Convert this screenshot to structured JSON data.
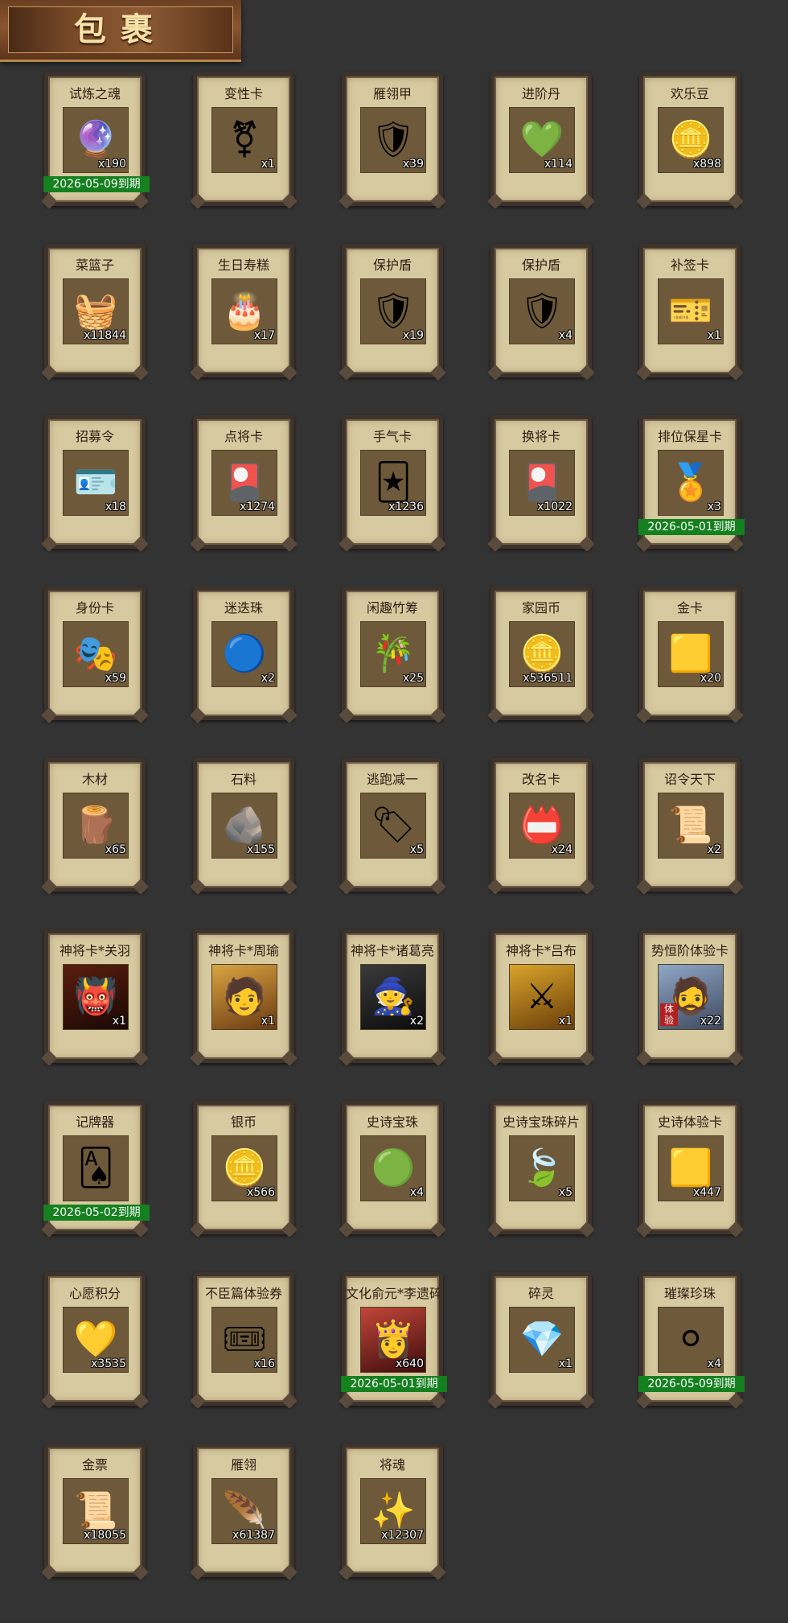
{
  "header": {
    "title": "包裹"
  },
  "colors": {
    "background": "#333333",
    "card": "#d8caa0",
    "expiry": "#15801f"
  },
  "items": [
    {
      "name": "试炼之魂",
      "count": "x190",
      "icon": "soul-orb-icon",
      "glyph": "🔮",
      "expiry": "2026-05-09到期"
    },
    {
      "name": "变性卡",
      "count": "x1",
      "icon": "gender-card-icon",
      "glyph": "⚧",
      "expiry": ""
    },
    {
      "name": "雁翎甲",
      "count": "x39",
      "icon": "armor-icon",
      "glyph": "🛡",
      "expiry": ""
    },
    {
      "name": "进阶丹",
      "count": "x114",
      "icon": "pill-icon",
      "glyph": "💚",
      "expiry": ""
    },
    {
      "name": "欢乐豆",
      "count": "x898",
      "icon": "beans-icon",
      "glyph": "🪙",
      "expiry": ""
    },
    {
      "name": "菜篮子",
      "count": "x11844",
      "icon": "basket-icon",
      "glyph": "🧺",
      "expiry": ""
    },
    {
      "name": "生日寿糕",
      "count": "x17",
      "icon": "cake-icon",
      "glyph": "🎂",
      "expiry": ""
    },
    {
      "name": "保护盾",
      "count": "x19",
      "icon": "shield-icon",
      "glyph": "🛡",
      "expiry": ""
    },
    {
      "name": "保护盾",
      "count": "x4",
      "icon": "shield-icon",
      "glyph": "🛡",
      "expiry": ""
    },
    {
      "name": "补签卡",
      "count": "x1",
      "icon": "sign-card-icon",
      "glyph": "🎫",
      "expiry": ""
    },
    {
      "name": "招募令",
      "count": "x18",
      "icon": "recruit-token-icon",
      "glyph": "🪪",
      "expiry": ""
    },
    {
      "name": "点将卡",
      "count": "x1274",
      "icon": "general-card-icon",
      "glyph": "🎴",
      "expiry": ""
    },
    {
      "name": "手气卡",
      "count": "x1236",
      "icon": "luck-card-icon",
      "glyph": "🃏",
      "expiry": ""
    },
    {
      "name": "换将卡",
      "count": "x1022",
      "icon": "swap-card-icon",
      "glyph": "🎴",
      "expiry": ""
    },
    {
      "name": "排位保星卡",
      "count": "x3",
      "icon": "rank-card-icon",
      "glyph": "🏅",
      "expiry": "2026-05-01到期"
    },
    {
      "name": "身份卡",
      "count": "x59",
      "icon": "identity-card-icon",
      "glyph": "🎭",
      "expiry": ""
    },
    {
      "name": "迷迭珠",
      "count": "x2",
      "icon": "blue-orb-icon",
      "glyph": "🔵",
      "expiry": ""
    },
    {
      "name": "闲趣竹筹",
      "count": "x25",
      "icon": "bamboo-token-icon",
      "glyph": "🎋",
      "expiry": ""
    },
    {
      "name": "家园币",
      "count": "x536511",
      "icon": "home-coin-icon",
      "glyph": "🪙",
      "expiry": ""
    },
    {
      "name": "金卡",
      "count": "x20",
      "icon": "gold-card-icon",
      "glyph": "🟨",
      "expiry": ""
    },
    {
      "name": "木材",
      "count": "x65",
      "icon": "wood-icon",
      "glyph": "🪵",
      "expiry": ""
    },
    {
      "name": "石料",
      "count": "x155",
      "icon": "stone-icon",
      "glyph": "🪨",
      "expiry": ""
    },
    {
      "name": "逃跑减一",
      "count": "x5",
      "icon": "jade-tag-icon",
      "glyph": "🏷",
      "expiry": ""
    },
    {
      "name": "改名卡",
      "count": "x24",
      "icon": "rename-card-icon",
      "glyph": "📛",
      "expiry": ""
    },
    {
      "name": "诏令天下",
      "count": "x2",
      "icon": "edict-scroll-icon",
      "glyph": "📜",
      "expiry": ""
    },
    {
      "name": "神将卡*关羽",
      "count": "x1",
      "icon": "guanyu-portrait-icon",
      "glyph": "👹",
      "expiry": "",
      "portrait": [
        "#5a1e0e",
        "#1a0805"
      ]
    },
    {
      "name": "神将卡*周瑜",
      "count": "x1",
      "icon": "zhouyu-portrait-icon",
      "glyph": "🧑",
      "expiry": "",
      "portrait": [
        "#d9a441",
        "#6b3a12"
      ]
    },
    {
      "name": "神将卡*诸葛亮",
      "count": "x2",
      "icon": "zhugeliang-portrait-icon",
      "glyph": "🧙",
      "expiry": "",
      "portrait": [
        "#3a3a3a",
        "#0c0c0c"
      ]
    },
    {
      "name": "神将卡*吕布",
      "count": "x1",
      "icon": "lvbu-portrait-icon",
      "glyph": "⚔",
      "expiry": "",
      "portrait": [
        "#d9a52b",
        "#6a3d0a"
      ]
    },
    {
      "name": "势恒阶体验卡",
      "count": "x22",
      "icon": "trial-portrait-icon",
      "glyph": "🧔",
      "expiry": "",
      "portrait": [
        "#8fa7c7",
        "#3e4a5e"
      ],
      "tag": "体验"
    },
    {
      "name": "记牌器",
      "count": "",
      "icon": "playing-cards-icon",
      "glyph": "🂡",
      "expiry": "2026-05-02到期"
    },
    {
      "name": "银币",
      "count": "x566",
      "icon": "silver-coin-icon",
      "glyph": "🪙",
      "expiry": ""
    },
    {
      "name": "史诗宝珠",
      "count": "x4",
      "icon": "green-orb-icon",
      "glyph": "🟢",
      "expiry": ""
    },
    {
      "name": "史诗宝珠碎片",
      "count": "x5",
      "icon": "green-shard-icon",
      "glyph": "🍃",
      "expiry": ""
    },
    {
      "name": "史诗体验卡",
      "count": "x447",
      "icon": "epic-card-icon",
      "glyph": "🟨",
      "expiry": ""
    },
    {
      "name": "心愿积分",
      "count": "x3535",
      "icon": "heart-coin-icon",
      "glyph": "💛",
      "expiry": ""
    },
    {
      "name": "不臣篇体验券",
      "count": "x16",
      "icon": "ticket-icon",
      "glyph": "🎟",
      "expiry": ""
    },
    {
      "name": "文化俞元*李遗碎片",
      "count": "x640",
      "icon": "hero-shard-portrait-icon",
      "glyph": "👸",
      "expiry": "2026-05-01到期",
      "portrait": [
        "#c2463a",
        "#3d0c0c"
      ]
    },
    {
      "name": "碎灵",
      "count": "x1",
      "icon": "crystal-icon",
      "glyph": "💎",
      "expiry": ""
    },
    {
      "name": "璀璨珍珠",
      "count": "x4",
      "icon": "pearl-icon",
      "glyph": "⚪",
      "expiry": "2026-05-09到期"
    },
    {
      "name": "金票",
      "count": "x18055",
      "icon": "gold-ticket-icon",
      "glyph": "📜",
      "expiry": ""
    },
    {
      "name": "雁翎",
      "count": "x61387",
      "icon": "feather-icon",
      "glyph": "🪶",
      "expiry": ""
    },
    {
      "name": "将魂",
      "count": "x12307",
      "icon": "general-soul-icon",
      "glyph": "✨",
      "expiry": ""
    }
  ]
}
